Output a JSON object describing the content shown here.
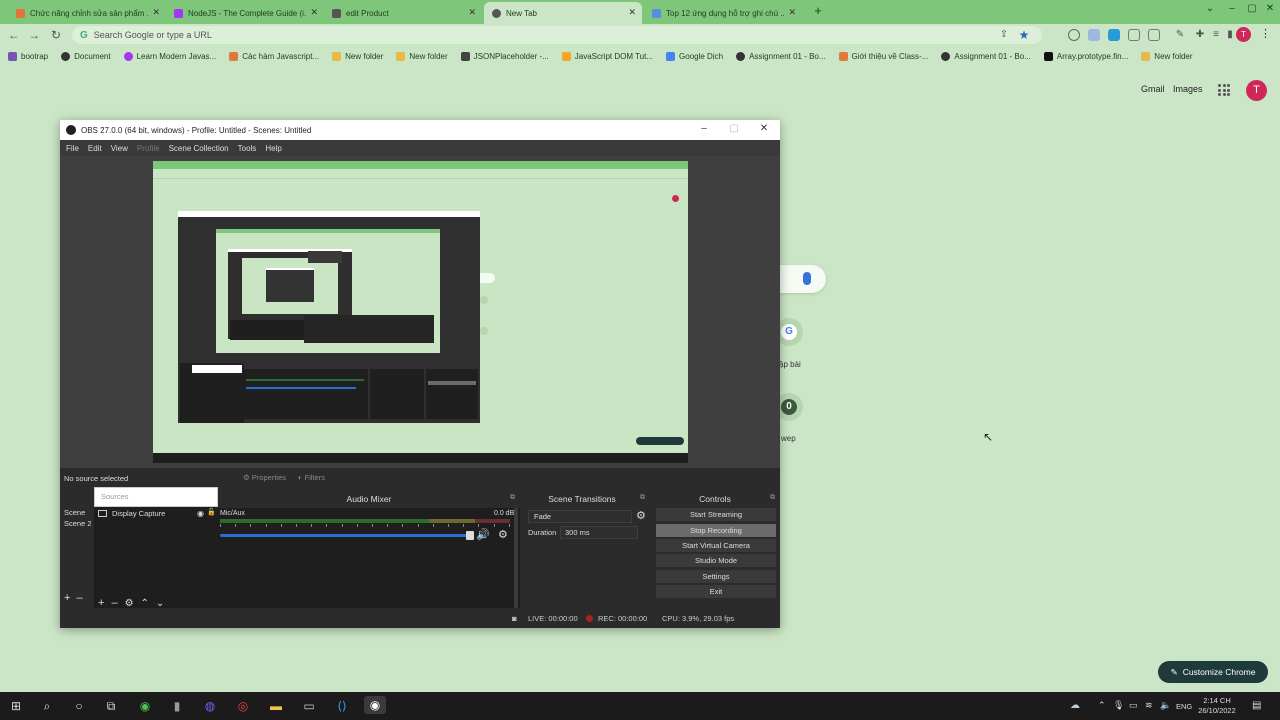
{
  "chrome": {
    "tabs": [
      {
        "title": "Chức năng chỉnh sửa sản phẩm ...",
        "fav_color": "#e0743a"
      },
      {
        "title": "NodeJS - The Complete Guide (i...",
        "fav_color": "#a435f0"
      },
      {
        "title": "edit Product",
        "fav_color": "#555555"
      },
      {
        "title": "New Tab",
        "fav_color": "#555555"
      },
      {
        "title": "Top 12 ứng dụng hỗ trợ ghi chú ...",
        "fav_color": "#5a8de0"
      }
    ],
    "new_tab_symbol": "+",
    "address_placeholder": "Search Google or type a URL",
    "profile_initial": "T",
    "bookmarks": [
      {
        "label": "bootrap",
        "icon_color": "#7952b3"
      },
      {
        "label": "Document",
        "icon_color": "#333333"
      },
      {
        "label": "Learn Modern Javas...",
        "icon_color": "#a435f0"
      },
      {
        "label": "Các hàm Javascript...",
        "icon_color": "#e07a3a"
      },
      {
        "label": "New folder",
        "icon_color": "#e8b84a"
      },
      {
        "label": "New folder",
        "icon_color": "#e8b84a"
      },
      {
        "label": "JSONPlaceholder -...",
        "icon_color": "#444444"
      },
      {
        "label": "JavaScript DOM Tut...",
        "icon_color": "#f5a623"
      },
      {
        "label": "Google Dịch",
        "icon_color": "#4285f4"
      },
      {
        "label": "Assignment 01 - Bo...",
        "icon_color": "#333333"
      },
      {
        "label": "Giới thiệu về Class-...",
        "icon_color": "#e07a3a"
      },
      {
        "label": "Assignment 01 - Bo...",
        "icon_color": "#333333"
      },
      {
        "label": "Array.prototype.fin...",
        "icon_color": "#111111"
      },
      {
        "label": "New folder",
        "icon_color": "#e8b84a"
      }
    ]
  },
  "newtab": {
    "gmail": "Gmail",
    "images": "Images",
    "avatar_initial": "T",
    "shortcut_1_label": "ập bài",
    "shortcut_2_label": "wep",
    "shortcut_2_letter": "0",
    "customize_label": "Customize Chrome"
  },
  "obs": {
    "title": "OBS 27.0.0 (64 bit, windows) - Profile: Untitled - Scenes: Untitled",
    "menu": [
      "File",
      "Edit",
      "View",
      "Profile",
      "Scene Collection",
      "Tools",
      "Help"
    ],
    "no_source": "No source selected",
    "properties": "Properties",
    "filters": "Filters",
    "scenes": [
      "Scene",
      "Scene 2"
    ],
    "sources_placeholder": "Sources",
    "source_item": "Display Capture",
    "mixer_title": "Audio Mixer",
    "mixer_channel": "Mic/Aux",
    "mixer_db": "0.0 dB",
    "transitions_title": "Scene Transitions",
    "transition_value": "Fade",
    "duration_label": "Duration",
    "duration_value": "300 ms",
    "controls_title": "Controls",
    "controls": [
      "Start Streaming",
      "Stop Recording",
      "Start Virtual Camera",
      "Studio Mode",
      "Settings",
      "Exit"
    ],
    "status_live": "LIVE: 00:00:00",
    "status_rec": "REC: 00:00:00",
    "status_cpu": "CPU: 3.9%, 29.03 fps"
  },
  "taskbar": {
    "lang": "ENG",
    "time": "2:14 CH",
    "date": "26/10/2022"
  }
}
